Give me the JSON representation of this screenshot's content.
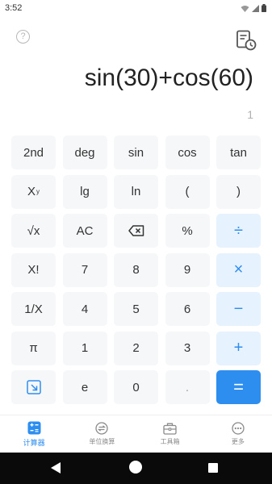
{
  "status": {
    "time": "3:52"
  },
  "display": {
    "expression": "sin(30)+cos(60)",
    "result": "1"
  },
  "keys": {
    "second": "2nd",
    "deg": "deg",
    "sin": "sin",
    "cos": "cos",
    "tan": "tan",
    "power_base": "X",
    "power_exp": "y",
    "lg": "lg",
    "ln": "ln",
    "lparen": "(",
    "rparen": ")",
    "sqrt": "√x",
    "ac": "AC",
    "percent": "%",
    "divide": "÷",
    "factorial": "X!",
    "seven": "7",
    "eight": "8",
    "nine": "9",
    "multiply": "×",
    "reciprocal": "1/X",
    "four": "4",
    "five": "5",
    "six": "6",
    "minus": "−",
    "pi": "π",
    "one": "1",
    "two": "2",
    "three": "3",
    "plus": "+",
    "e": "e",
    "zero": "0",
    "dot": ".",
    "equals": "="
  },
  "tabs": [
    {
      "label": "计算器",
      "icon": "calculator-icon",
      "active": true
    },
    {
      "label": "单位换算",
      "icon": "unit-convert-icon",
      "active": false
    },
    {
      "label": "工具箱",
      "icon": "toolbox-icon",
      "active": false
    },
    {
      "label": "更多",
      "icon": "more-icon",
      "active": false
    }
  ],
  "colors": {
    "accent": "#2e8ef0",
    "key_bg": "#f5f7f9",
    "op_bg": "#e6f2fd"
  }
}
